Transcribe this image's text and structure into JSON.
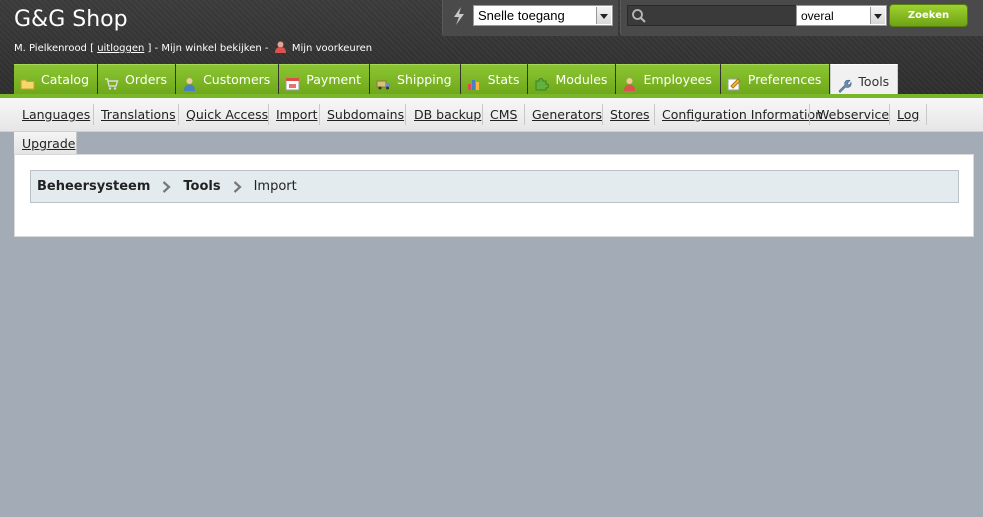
{
  "header": {
    "shop_name": "G&G Shop",
    "user_name": "M. Pielkenrood",
    "bracket_open": "[",
    "logout_label": "uitloggen",
    "bracket_close": "]",
    "sep1": "-",
    "view_shop_label": "Mijn winkel bekijken",
    "sep2": "-",
    "preferences_label": "Mijn voorkeuren"
  },
  "quick_access": {
    "selected": "Snelle toegang"
  },
  "search": {
    "query": "",
    "scope": "overal",
    "button_label": "Zoeken"
  },
  "tabs": [
    {
      "label": "Catalog",
      "icon": "folder-icon"
    },
    {
      "label": "Orders",
      "icon": "cart-icon"
    },
    {
      "label": "Customers",
      "icon": "user-icon"
    },
    {
      "label": "Payment",
      "icon": "payment-icon"
    },
    {
      "label": "Shipping",
      "icon": "truck-icon"
    },
    {
      "label": "Stats",
      "icon": "bar-chart-icon"
    },
    {
      "label": "Modules",
      "icon": "puzzle-icon"
    },
    {
      "label": "Employees",
      "icon": "employee-icon"
    },
    {
      "label": "Preferences",
      "icon": "preferences-icon"
    },
    {
      "label": "Tools",
      "icon": "wrench-icon",
      "active": true
    }
  ],
  "subtabs": [
    "Languages",
    "Translations",
    "Quick Access",
    "Import",
    "Subdomains",
    "DB backup",
    "CMS",
    "Generators",
    "Stores",
    "Configuration Information",
    "Webservice",
    "Log",
    "Upgrade"
  ],
  "breadcrumb": {
    "level1": "Beheersysteem",
    "level2": "Tools",
    "level3": "Import"
  },
  "colors": {
    "tab_green": "#7ab62a",
    "background": "#a3abb6",
    "header_dark": "#333333"
  }
}
